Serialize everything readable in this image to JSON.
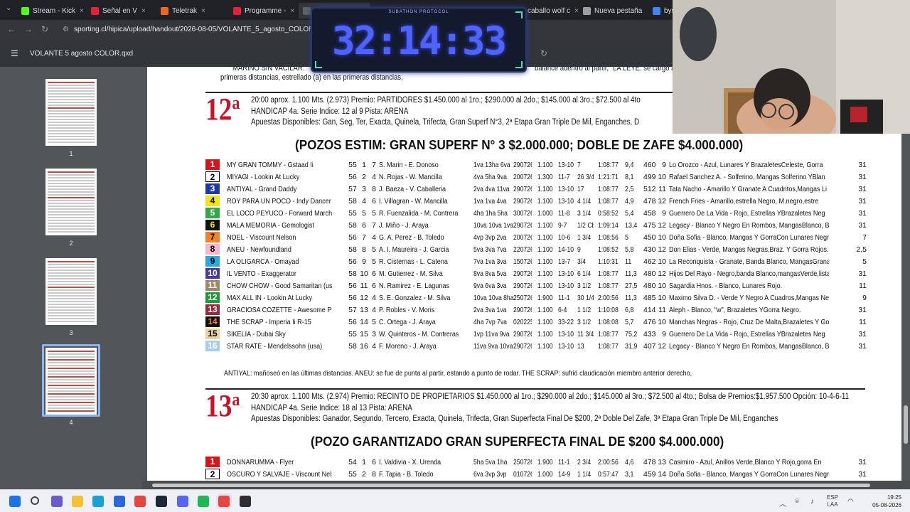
{
  "browser": {
    "tabs": [
      {
        "label": "Stream - Kick",
        "color": "#53fc18"
      },
      {
        "label": "Señal en V",
        "color": "#e8203a"
      },
      {
        "label": "Teletrak",
        "color": "#f26522"
      },
      {
        "label": "Programme -",
        "color": "#e8203a"
      },
      {
        "label": "",
        "color": "#5f6368"
      },
      {
        "label": "caballo wolf c",
        "color": "#9aa0a6"
      },
      {
        "label": "Nueva pestaña",
        "color": "#9aa0a6"
      },
      {
        "label": "bys",
        "color": "#4285f4"
      }
    ],
    "url": "sporting.cl/hipica/upload/handout/2026-08-05/VOLANTE_5_agosto_COLOR.pdf"
  },
  "pdf": {
    "title": "VOLANTE 5 agosto COLOR.qxd",
    "thumbnails": [
      "1",
      "2",
      "3",
      "4"
    ],
    "selected_page": "4"
  },
  "timer": {
    "value": "32:14:33",
    "caption": "SUBATHON PROTOCOL"
  },
  "document": {
    "top_note_1": "MARINO SIN VACILAR:",
    "top_note_1b": "balance adentro al partir,  \"LA LEYE: se cargó al p",
    "top_note_2": "primeras distancias, estrellado (a) en las primeras distancias,",
    "race12": {
      "number": "12",
      "sup": "a",
      "line1": "20:00 aprox. 1.100 Mts. (2.973)   Premio: PARTIDORES     $1.450.000 al 1ro.; $290.000 al 2do.; $145.000 al 3ro.; $72.500 al 4to",
      "line2": "HANDICAP   4a. Serie  Indice: 12 al 9 Pista: ARENA",
      "line3": "Apuestas Disponibles: Gan, Seg, Ter, Exacta, Quinela, Trifecta, Gran Superf N°3, 2ª Etapa Gran Triple De Mil, Enganches, D",
      "pozos": "(POZOS ESTIM: GRAN SUPERF N° 3 $2.000.000; DOBLE DE ZAFE  $4.000.000)",
      "runners": [
        {
          "n": "1",
          "bg": "#d7141a",
          "fg": "#fff",
          "horse": "MY GRAN TOMMY - Gstaad Ii",
          "kg": "55",
          "pp": "1",
          "dv": "7",
          "jk": "S. Marin - E. Donoso",
          "ult": "1va 13ha 6va",
          "fe": "290726",
          "dist": "1.100",
          "cat": "13-10",
          "ubic": "7",
          "tiempo": "1:08:77",
          "div": "9,4",
          "peso": "460",
          "ed": "9",
          "studio": "Lo Orozco - Azul, Lunares Y BrazaletesCeleste, Gorra",
          "gan": "31"
        },
        {
          "n": "2",
          "bg": "#ffffff",
          "fg": "#000",
          "horse": "MIYAGI - Lookin At Lucky",
          "kg": "56",
          "pp": "2",
          "dv": "4",
          "jk": "N. Rojas - W. Mancilla",
          "ult": "4va 5ha 9va",
          "fe": "200726",
          "dist": "1.300",
          "cat": "11-7",
          "ubic": "26 3/4",
          "tiempo": "1:21:71",
          "div": "8,1",
          "peso": "499",
          "ed": "10",
          "studio": "Rafael Sanchez A. - Solferino, Mangas Solferino YBlan",
          "gan": "31"
        },
        {
          "n": "3",
          "bg": "#1f3aa6",
          "fg": "#fff",
          "horse": "ANTIYAL - Grand Daddy",
          "kg": "57",
          "pp": "3",
          "dv": "8",
          "jk": "J. Baeza - V. Caballeria",
          "ult": "2va 4va 11va",
          "fe": "290726",
          "dist": "1.100",
          "cat": "13-10",
          "ubic": "17",
          "tiempo": "1:08:77",
          "div": "2,5",
          "peso": "512",
          "ed": "11",
          "studio": "Tata Nacho - Amarillo Y Granate A Cuadritos,Mangas Li",
          "gan": "31"
        },
        {
          "n": "4",
          "bg": "#f2e21a",
          "fg": "#000",
          "horse": "ROY PARA UN POCO - Indy Dancer",
          "kg": "58",
          "pp": "4",
          "dv": "6",
          "jk": "I. Villagran - W. Mancilla",
          "ult": "1va 1va 4va",
          "fe": "290726",
          "dist": "1.100",
          "cat": "13-10",
          "ubic": "4 1/4",
          "tiempo": "1:08:77",
          "div": "4,9",
          "peso": "478",
          "ed": "12",
          "studio": "French Fries - Amarillo,estrella Negro, M.negro,estre",
          "gan": "31"
        },
        {
          "n": "5",
          "bg": "#33a64a",
          "fg": "#fff",
          "horse": "EL LOCO PEYUCO - Forward March",
          "kg": "55",
          "pp": "5",
          "dv": "5",
          "jk": "R. Fuenzalida - M. Contreras",
          "ult": "4ha 1ha 5ha",
          "fe": "300726",
          "dist": "1.000",
          "cat": "11-8",
          "ubic": "3 1/4",
          "tiempo": "0:58:52",
          "div": "5,4",
          "peso": "458",
          "ed": "9",
          "studio": "Guerrero De La Vida - Rojo, Estrellas YBrazaletes Neg",
          "gan": "31"
        },
        {
          "n": "6",
          "bg": "#111111",
          "fg": "#f2e21a",
          "horse": "MALA MEMORIA - Gemologist",
          "kg": "58",
          "pp": "6",
          "dv": "7",
          "jk": "J. Miño - J. Araya",
          "ult": "10va 10va 1va",
          "fe": "290726",
          "dist": "1.100",
          "cat": "9-7",
          "ubic": "1/2 Cbz",
          "tiempo": "1:09:14",
          "div": "13,4",
          "peso": "475",
          "ed": "12",
          "studio": "Legacy - Blanco Y Negro En Rombos, MangasBlanco, Braz",
          "gan": "31"
        },
        {
          "n": "7",
          "bg": "#f0822a",
          "fg": "#000",
          "horse": "NOEL - Viscount Nelson",
          "kg": "56",
          "pp": "7",
          "dv": "4",
          "jk": "G. A. Perez - B. Toledo",
          "ult": "4vp 3vp 2va",
          "fe": "200726",
          "dist": "1.100",
          "cat": "10-6",
          "ubic": "1 3/4",
          "tiempo": "1:08:56",
          "div": "5",
          "peso": "450",
          "ed": "10",
          "studio": "Doña Sofia - Blanco, Mangas Y GorraCon Lunares Negros",
          "gan": "7"
        },
        {
          "n": "8",
          "bg": "#f4b6cf",
          "fg": "#000",
          "horse": "ANEU - Newfoundland",
          "kg": "58",
          "pp": "8",
          "dv": "5",
          "jk": "A. I. Maureira - J. Garcia",
          "ult": "5va 3va 7va",
          "fe": "220726",
          "dist": "1.100",
          "cat": "14-10",
          "ubic": "9",
          "tiempo": "1:08:52",
          "div": "5,8",
          "peso": "430",
          "ed": "12",
          "studio": "Don Elias - Verde, Mangas Negras,Braz. Y Gorra Rojos.",
          "gan": "2,5"
        },
        {
          "n": "9",
          "bg": "#29a9e0",
          "fg": "#000",
          "horse": "LA OLIGARCA - Omayad",
          "kg": "56",
          "pp": "9",
          "dv": "5",
          "jk": "R. Cisternas - L. Catena",
          "ult": "7va 1va 3va",
          "fe": "150726",
          "dist": "1.100",
          "cat": "13-7",
          "ubic": "3/4",
          "tiempo": "1:10:31",
          "div": "11",
          "peso": "462",
          "ed": "10",
          "studio": "La Reconquista - Granate, Banda Blanco, MangasGranate",
          "gan": "5"
        },
        {
          "n": "10",
          "bg": "#4a3aa0",
          "fg": "#fff",
          "horse": "IL VENTO - Exaggerator",
          "kg": "58",
          "pp": "10",
          "dv": "6",
          "jk": "M. Gutierrez - M. Silva",
          "ult": "8va 8va 5va",
          "fe": "290726",
          "dist": "1.100",
          "cat": "13-10",
          "ubic": "6 1/4",
          "tiempo": "1:08:77",
          "div": "11,3",
          "peso": "480",
          "ed": "12",
          "studio": "Hijos Del Rayo - Negro,banda Blanco,mangasVerde,lista",
          "gan": "31"
        },
        {
          "n": "11",
          "bg": "#9a8a6a",
          "fg": "#fff",
          "horse": "CHOW CHOW - Good Samaritan (usa)",
          "kg": "56",
          "pp": "11",
          "dv": "6",
          "jk": "N. Ramirez - E. Lagunas",
          "ult": "9va 6va 3va",
          "fe": "290726",
          "dist": "1.100",
          "cat": "13-10",
          "ubic": "3 1/2",
          "tiempo": "1:08:77",
          "div": "27,5",
          "peso": "480",
          "ed": "10",
          "studio": "Sagardia Hnos. - Blanco, Lunares Rojo.",
          "gan": "11"
        },
        {
          "n": "12",
          "bg": "#1e9a3a",
          "fg": "#fff",
          "horse": "MAX ALL IN - Lookin At Lucky",
          "kg": "56",
          "pp": "12",
          "dv": "4",
          "jk": "S. E. Gonzalez - M. Silva",
          "ult": "10va 10va 8ha",
          "fe": "250726",
          "dist": "1.900",
          "cat": "11-1",
          "ubic": "30 1/4",
          "tiempo": "2:00:56",
          "div": "11,3",
          "peso": "485",
          "ed": "10",
          "studio": "Maximo Silva D. - Verde Y Negro A Cuadros,Mangas Negr",
          "gan": "9"
        },
        {
          "n": "13",
          "bg": "#9a2a3a",
          "fg": "#fff",
          "horse": "GRACIOSA COZETTE - Awesome Patriot",
          "kg": "57",
          "pp": "13",
          "dv": "4",
          "jk": "P. Robles - V. Moris",
          "ult": "2va 3va 1va",
          "fe": "290726",
          "dist": "1.100",
          "cat": "6-4",
          "ubic": "1 1/2",
          "tiempo": "1:10:08",
          "div": "6,8",
          "peso": "414",
          "ed": "11",
          "studio": "Aleph - Blanco, \"w\", Brazaletes YGorra Negro.",
          "gan": "31"
        },
        {
          "n": "14",
          "bg": "#111111",
          "fg": "#f0822a",
          "horse": "THE SCRAP - Imperia Ii R-15",
          "kg": "56",
          "pp": "14",
          "dv": "5",
          "jk": "C. Ortega - J. Araya",
          "ult": "4ha 7vp 7va",
          "fe": "020225",
          "dist": "1.100",
          "cat": "33-22",
          "ubic": "3 1/2",
          "tiempo": "1:08:08",
          "div": "5,7",
          "peso": "476",
          "ed": "10",
          "studio": "Manchas Negras - Rojo, Cruz De Malta,Brazaletes Y Gor",
          "gan": "11"
        },
        {
          "n": "15",
          "bg": "#e8d49a",
          "fg": "#000",
          "horse": "SIKELIA - Dubai Sky",
          "kg": "55",
          "pp": "15",
          "dv": "3",
          "jk": "W. Quinteros - M. Contreras",
          "ult": "1vp 11va 9va",
          "fe": "290726",
          "dist": "1.100",
          "cat": "13-10",
          "ubic": "11 3/4",
          "tiempo": "1:08:77",
          "div": "75,2",
          "peso": "433",
          "ed": "9",
          "studio": "Guerrero De La Vida - Rojo, Estrellas YBrazaletes Neg",
          "gan": "31"
        },
        {
          "n": "16",
          "bg": "#a8cfe8",
          "fg": "#fff",
          "horse": "STAR RATE - Mendelssohn (usa)",
          "kg": "58",
          "pp": "16",
          "dv": "4",
          "jk": "F. Moreno - J. Araya",
          "ult": "11va 9va 10va",
          "fe": "290726",
          "dist": "1.100",
          "cat": "13-10",
          "ubic": "13",
          "tiempo": "1:08:77",
          "div": "31,9",
          "peso": "407",
          "ed": "12",
          "studio": "Legacy - Blanco Y Negro En Rombos, MangasBlanco, Braz",
          "gan": "31"
        }
      ],
      "notes": "ANTIYAL: mañoseó en las últimas distancias.       ANEU: se fue de punta al partir, estando a punto de rodar.       THE SCRAP: sufrió claudicación miembro anterior derecho,"
    },
    "race13": {
      "number": "13",
      "sup": "a",
      "line1": "20:30 aprox. 1.100 Mts. (2.974)   Premio: RECINTO DE PROPIETARIOS  $1.450.000 al 1ro.; $290.000 al 2do.; $145.000 al 3ro.; $72.500 al 4to.;  Bolsa de Premios:$1.957.500  Opción: 10-4-6-11",
      "line2": "HANDICAP   4a. Serie  Indice: 18 al 13 Pista: ARENA",
      "line3": "Apuestas Disponibles: Ganador, Segundo, Tercero, Exacta, Quinela, Trifecta, Gran Superfecta Final De $200, 2ª Doble Del Zafe, 3ª Etapa Gran Triple De Mil, Enganches",
      "pozos": "(POZO GARANTIZADO GRAN SUPERFECTA FINAL DE $200  $4.000.000)",
      "runners": [
        {
          "n": "1",
          "bg": "#d7141a",
          "fg": "#fff",
          "horse": "DONNARUMMA - Flyer",
          "kg": "54",
          "pp": "1",
          "dv": "6",
          "jk": "I. Valdivia - X. Urenda",
          "ult": "5ha 5va 1ha",
          "fe": "250726",
          "dist": "1.900",
          "cat": "11-1",
          "ubic": "2 3/4",
          "tiempo": "2:00:56",
          "div": "4,6",
          "peso": "478",
          "ed": "13",
          "studio": "Casimiro - Azul, Anillos Verde,Blanco Y Rojo,gorra En",
          "gan": "31"
        },
        {
          "n": "2",
          "bg": "#ffffff",
          "fg": "#000",
          "horse": "OSCURO Y SALVAJE - Viscount Nelson",
          "kg": "55",
          "pp": "2",
          "dv": "8",
          "jk": "F. Tapia - B. Toledo",
          "ult": "6va 3vp 3vp",
          "fe": "010726",
          "dist": "1.000",
          "cat": "14-9",
          "ubic": "1 1/4",
          "tiempo": "0:57:47",
          "div": "3,1",
          "peso": "459",
          "ed": "14",
          "studio": "Doña Sofia - Blanco, Mangas Y GorraCon Lunares Negros",
          "gan": "31"
        }
      ]
    }
  },
  "taskbar": {
    "lang": "ESP",
    "lang2": "LAA",
    "time": "19:25",
    "date": "05-08-2026",
    "icons": [
      {
        "name": "windows-start-icon",
        "color": "#1a73e8"
      },
      {
        "name": "search-icon",
        "color": "#444"
      },
      {
        "name": "copilot-icon",
        "color": "#6a5acd"
      },
      {
        "name": "file-explorer-icon",
        "color": "#f2c230"
      },
      {
        "name": "edge-icon",
        "color": "#1aa0d8"
      },
      {
        "name": "store-icon",
        "color": "#2a6ad8"
      },
      {
        "name": "chrome-icon",
        "color": "#e8453c"
      },
      {
        "name": "steam-icon",
        "color": "#1b2838"
      },
      {
        "name": "discord-icon",
        "color": "#5865f2"
      },
      {
        "name": "spotify-icon",
        "color": "#1db954"
      },
      {
        "name": "chrome-active-icon",
        "color": "#e8453c"
      },
      {
        "name": "obs-icon",
        "color": "#302e31"
      }
    ]
  }
}
